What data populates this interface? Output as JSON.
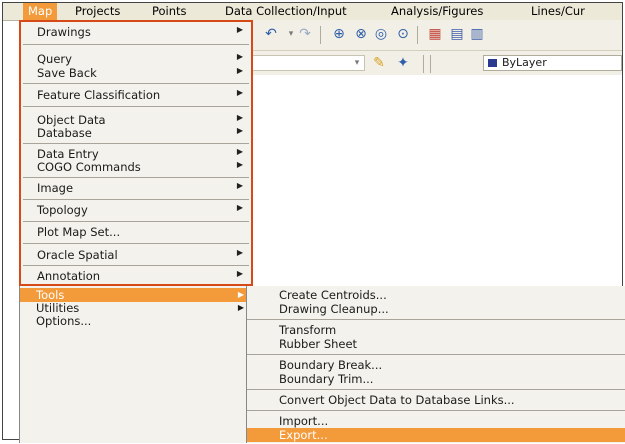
{
  "menubar": {
    "items": [
      {
        "label": "Map",
        "active": true
      },
      {
        "label": "Projects"
      },
      {
        "label": "Points"
      },
      {
        "label": "Data Collection/Input"
      },
      {
        "label": "Analysis/Figures"
      },
      {
        "label": "Lines/Cur"
      }
    ]
  },
  "toolbar": {
    "layer_value": "ByLayer",
    "layer_color": "#2b3a8f",
    "icons": [
      "undo-icon",
      "redo-icon",
      "zoom-extents-icon",
      "zoom-window-icon",
      "zoom-previous-icon",
      "zoom-realtime-icon",
      "layer-manager-icon",
      "grid-icon",
      "match-properties-icon",
      "layer-state-icon"
    ]
  },
  "map_menu": {
    "items": [
      {
        "label": "Drawings",
        "submenu": true
      },
      {
        "label": "Query",
        "submenu": true
      },
      {
        "label": "Save Back",
        "submenu": true
      },
      {
        "label": "Feature Classification",
        "submenu": true
      },
      {
        "label": "Object Data",
        "submenu": true
      },
      {
        "label": "Database",
        "submenu": true
      },
      {
        "label": "Data Entry",
        "submenu": true
      },
      {
        "label": "COGO Commands",
        "submenu": true
      },
      {
        "label": "Image",
        "submenu": true
      },
      {
        "label": "Topology",
        "submenu": true
      },
      {
        "label": "Plot Map Set...",
        "submenu": false
      },
      {
        "label": "Oracle Spatial",
        "submenu": true
      },
      {
        "label": "Annotation",
        "submenu": true
      },
      {
        "label": "Tools",
        "submenu": true,
        "highlighted": true
      },
      {
        "label": "Utilities",
        "submenu": true
      },
      {
        "label": "Options...",
        "submenu": false
      }
    ]
  },
  "tools_submenu": {
    "items": [
      {
        "label": "Create Centroids..."
      },
      {
        "label": "Drawing Cleanup..."
      },
      {
        "label": "Transform"
      },
      {
        "label": "Rubber Sheet"
      },
      {
        "label": "Boundary Break..."
      },
      {
        "label": "Boundary Trim..."
      },
      {
        "label": "Convert Object Data to Database Links..."
      },
      {
        "label": "Import..."
      },
      {
        "label": "Export...",
        "highlighted": true
      }
    ]
  },
  "colors": {
    "highlight": "#f39a3a",
    "menu_border": "#d64a1a",
    "menu_bg": "#f4f2ec",
    "menubar_bg": "#ece9d8"
  }
}
